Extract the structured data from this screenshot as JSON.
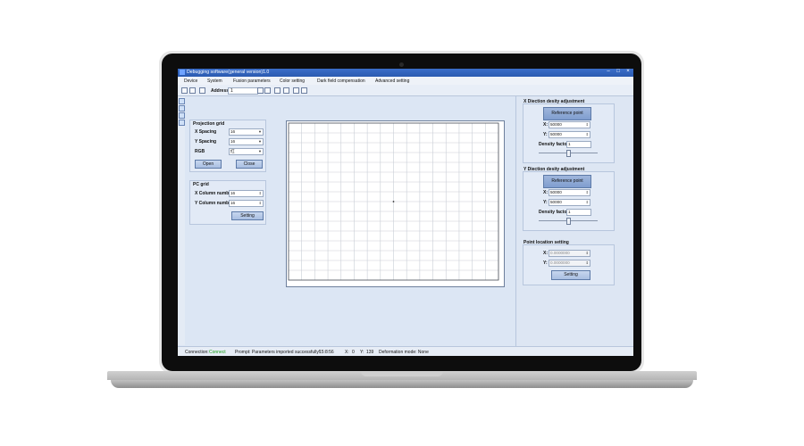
{
  "window": {
    "title": "Debugging software(general version)1.0"
  },
  "menu": {
    "items": [
      "Device",
      "System",
      "Fusion parameters",
      "Color setting",
      "Dark field compensation",
      "Advanced setting"
    ]
  },
  "toolbar": {
    "address_label": "Address",
    "address_value": "1"
  },
  "projection_grid": {
    "title": "Projection grid",
    "x_spacing_label": "X Spacing",
    "x_spacing_value": "16",
    "y_spacing_label": "Y Spacing",
    "y_spacing_value": "16",
    "rgb_label": "RGB",
    "rgb_value": "红",
    "open_label": "Open",
    "close_label": "Close"
  },
  "pc_grid": {
    "title": "PC grid",
    "x_column_label": "X Column number",
    "x_column_value": "16",
    "y_column_label": "Y Column number",
    "y_column_value": "16",
    "setting_label": "Setting"
  },
  "x_density": {
    "title": "X Diection desity adjustment",
    "ref_button": "Reference point selection",
    "x_label": "X:",
    "x_value": "50000",
    "y_label": "Y:",
    "y_value": "50000",
    "density_label": "Density factor",
    "density_value": "1",
    "slider_level": 0.5
  },
  "y_density": {
    "title": "Y Diection desity adjustment",
    "ref_button": "Reference point selection",
    "x_label": "X:",
    "x_value": "50000",
    "y_label": "Y:",
    "y_value": "50000",
    "density_label": "Density factor",
    "density_value": "1",
    "slider_level": 0.5
  },
  "point_location": {
    "title": "Point location setting",
    "x_label": "X:",
    "x_value": "0.0000000",
    "y_label": "Y:",
    "y_value": "0.0000000",
    "setting_label": "Setting"
  },
  "status": {
    "connection_label": "Connection:",
    "connection_value": "Connect",
    "prompt": "Prompt: Parameters imported successfully!",
    "time": "15:8:56",
    "x_label": "X:",
    "x_value": "0",
    "y_label": "Y:",
    "y_value": "139",
    "deformation": "Deformation mode: None"
  },
  "colors": {
    "titlebar": "#2a5ab0",
    "panel_bg": "#dce6f4",
    "connect_green": "#159b15"
  }
}
